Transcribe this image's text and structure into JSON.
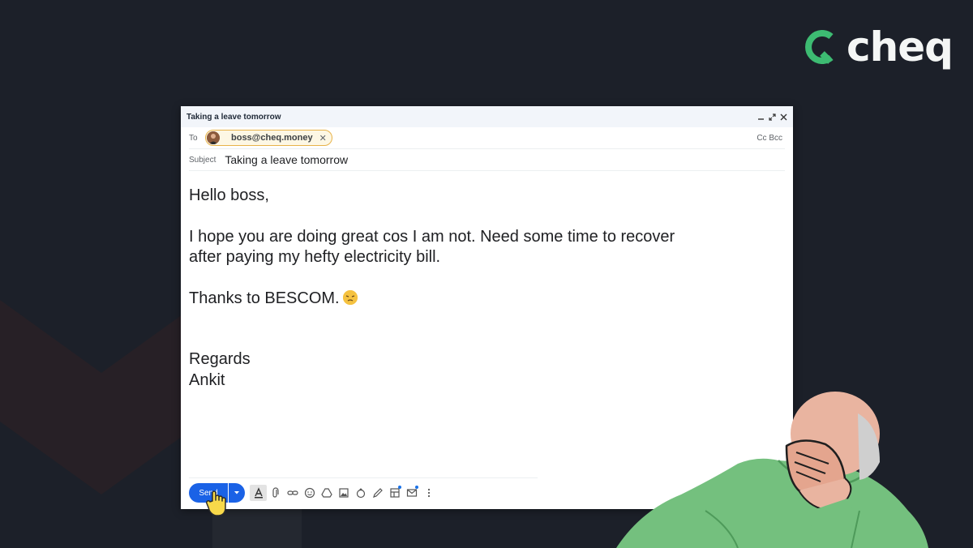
{
  "brand": {
    "name": "cheq",
    "accent": "#3dbb72"
  },
  "compose": {
    "title": "Taking a leave tomorrow",
    "to_label": "To",
    "recipient": "boss@cheq.money",
    "cc_bcc": "Cc Bcc",
    "subject_label": "Subject",
    "subject": "Taking a leave tomorrow",
    "body": {
      "greeting": "Hello boss,",
      "line1": "I hope you are doing great cos I am not. Need some time to recover",
      "line2": "after paying my hefty electricity bill.",
      "line3": "Thanks to BESCOM.",
      "signoff": "Regards",
      "signature": "Ankit"
    },
    "send_label": "Send",
    "send_color": "#1a62e6"
  },
  "icons": [
    "minimize-icon",
    "popout-icon",
    "close-icon",
    "remove-recipient-icon",
    "send-options-icon",
    "format-text-icon",
    "attach-icon",
    "link-icon",
    "emoji-icon",
    "drive-icon",
    "photo-icon",
    "lock-icon",
    "signature-icon",
    "layouts-icon",
    "schedule-icon",
    "more-options-icon",
    "pointer-hand-icon"
  ]
}
